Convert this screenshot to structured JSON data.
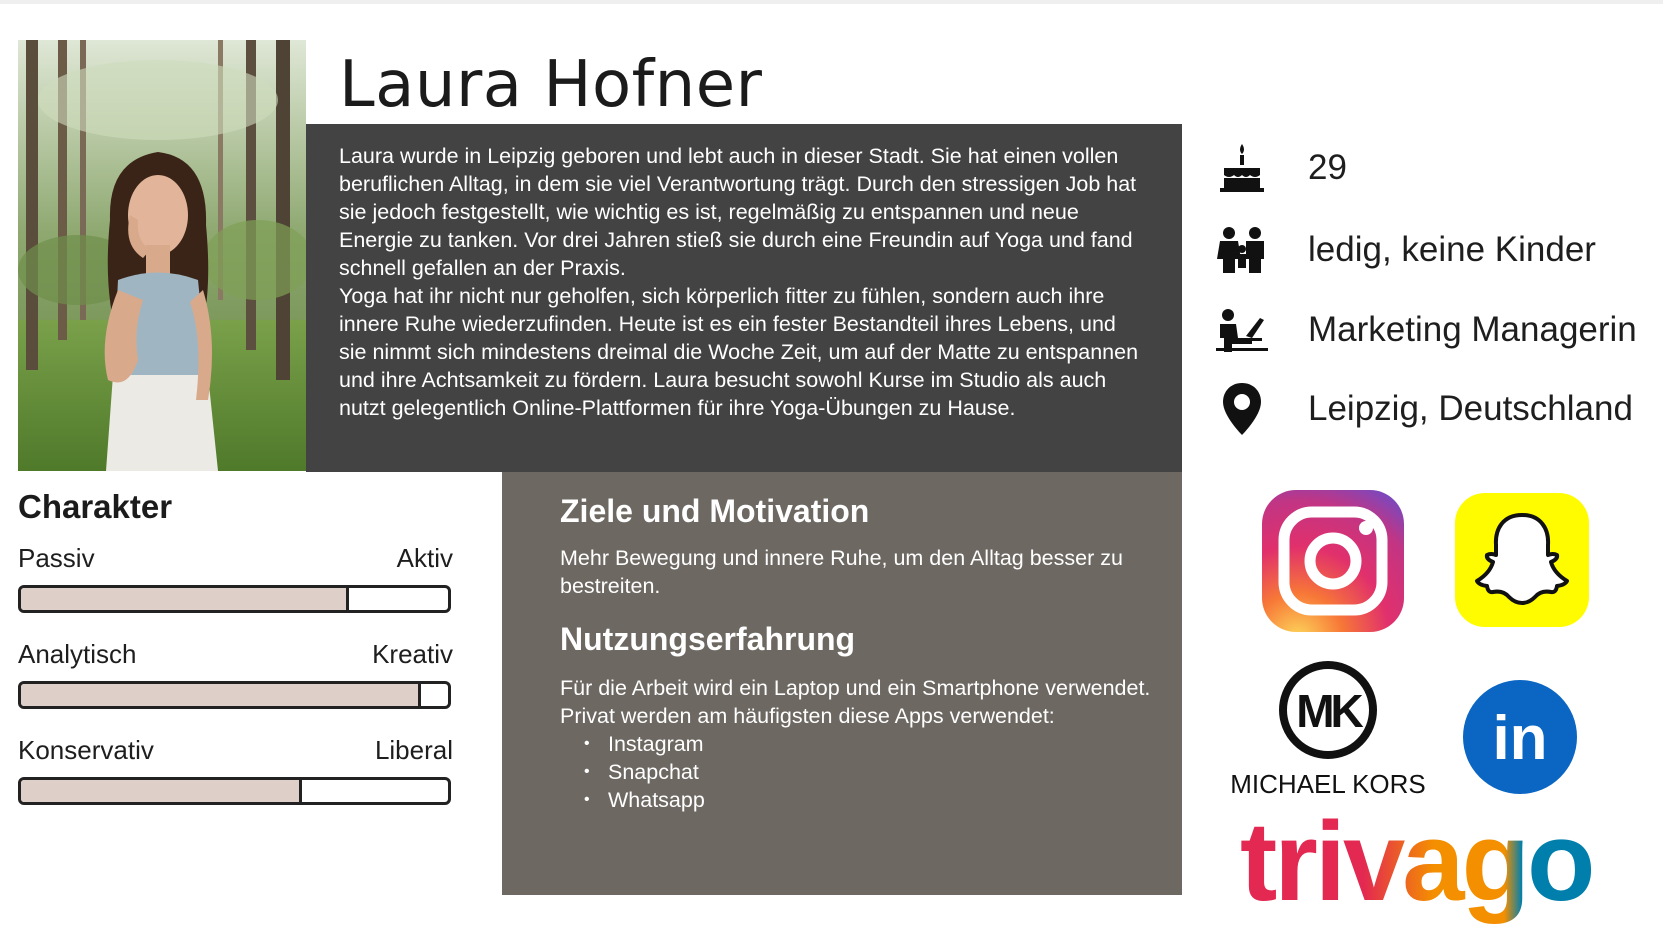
{
  "persona": {
    "name": "Laura Hofner",
    "bio": [
      "Laura wurde in Leipzig geboren und lebt auch in dieser Stadt. Sie hat einen vollen beruflichen Alltag, in dem sie viel Verantwortung trägt. Durch den stressigen Job hat sie jedoch festgestellt, wie wichtig es ist, regelmäßig zu entspannen und neue Energie zu tanken. Vor drei Jahren stieß sie durch eine Freundin auf Yoga und fand schnell gefallen an der Praxis.",
      "Yoga hat ihr nicht nur geholfen, sich körperlich fitter zu fühlen, sondern auch ihre innere Ruhe wiederzufinden. Heute ist es ein fester Bestandteil ihres Lebens, und sie nimmt sich mindestens dreimal die Woche Zeit, um auf der Matte zu entspannen und ihre Achtsamkeit zu fördern. Laura besucht sowohl Kurse im Studio als auch nutzt gelegentlich Online-Plattformen für ihre Yoga-Übungen zu Hause."
    ]
  },
  "facts": [
    {
      "icon": "birthday-cake-icon",
      "text": "29"
    },
    {
      "icon": "family-icon",
      "text": "ledig, keine Kinder"
    },
    {
      "icon": "person-at-laptop-icon",
      "text": "Marketing Managerin"
    },
    {
      "icon": "location-pin-icon",
      "text": "Leipzig, Deutschland"
    }
  ],
  "character": {
    "title": "Charakter",
    "traits": [
      {
        "left": "Passiv",
        "right": "Aktiv",
        "value": 0.76
      },
      {
        "left": "Analytisch",
        "right": "Kreativ",
        "value": 0.93
      },
      {
        "left": "Konservativ",
        "right": "Liberal",
        "value": 0.65
      }
    ]
  },
  "goals": {
    "title": "Ziele und Motivation",
    "text": "Mehr Bewegung und innere Ruhe, um den Alltag besser zu bestreiten."
  },
  "usage": {
    "title": "Nutzungserfahrung",
    "text1": "Für die Arbeit wird ein Laptop und ein Smartphone verwendet.",
    "text2": "Privat werden am häufigsten diese Apps verwendet:",
    "apps": [
      "Instagram",
      "Snapchat",
      "Whatsapp"
    ]
  },
  "brands": {
    "michael_kors_monogram": "MK",
    "michael_kors_wordmark": "MICHAEL KORS",
    "linkedin_mark": "in",
    "trivago_wordmark": "trivago"
  },
  "colors": {
    "bio_bg": "#434343",
    "goals_bg": "#6d6862",
    "trait_fill": "#ded0c8",
    "linkedin": "#0a66c2",
    "snapchat": "#fffc00"
  }
}
